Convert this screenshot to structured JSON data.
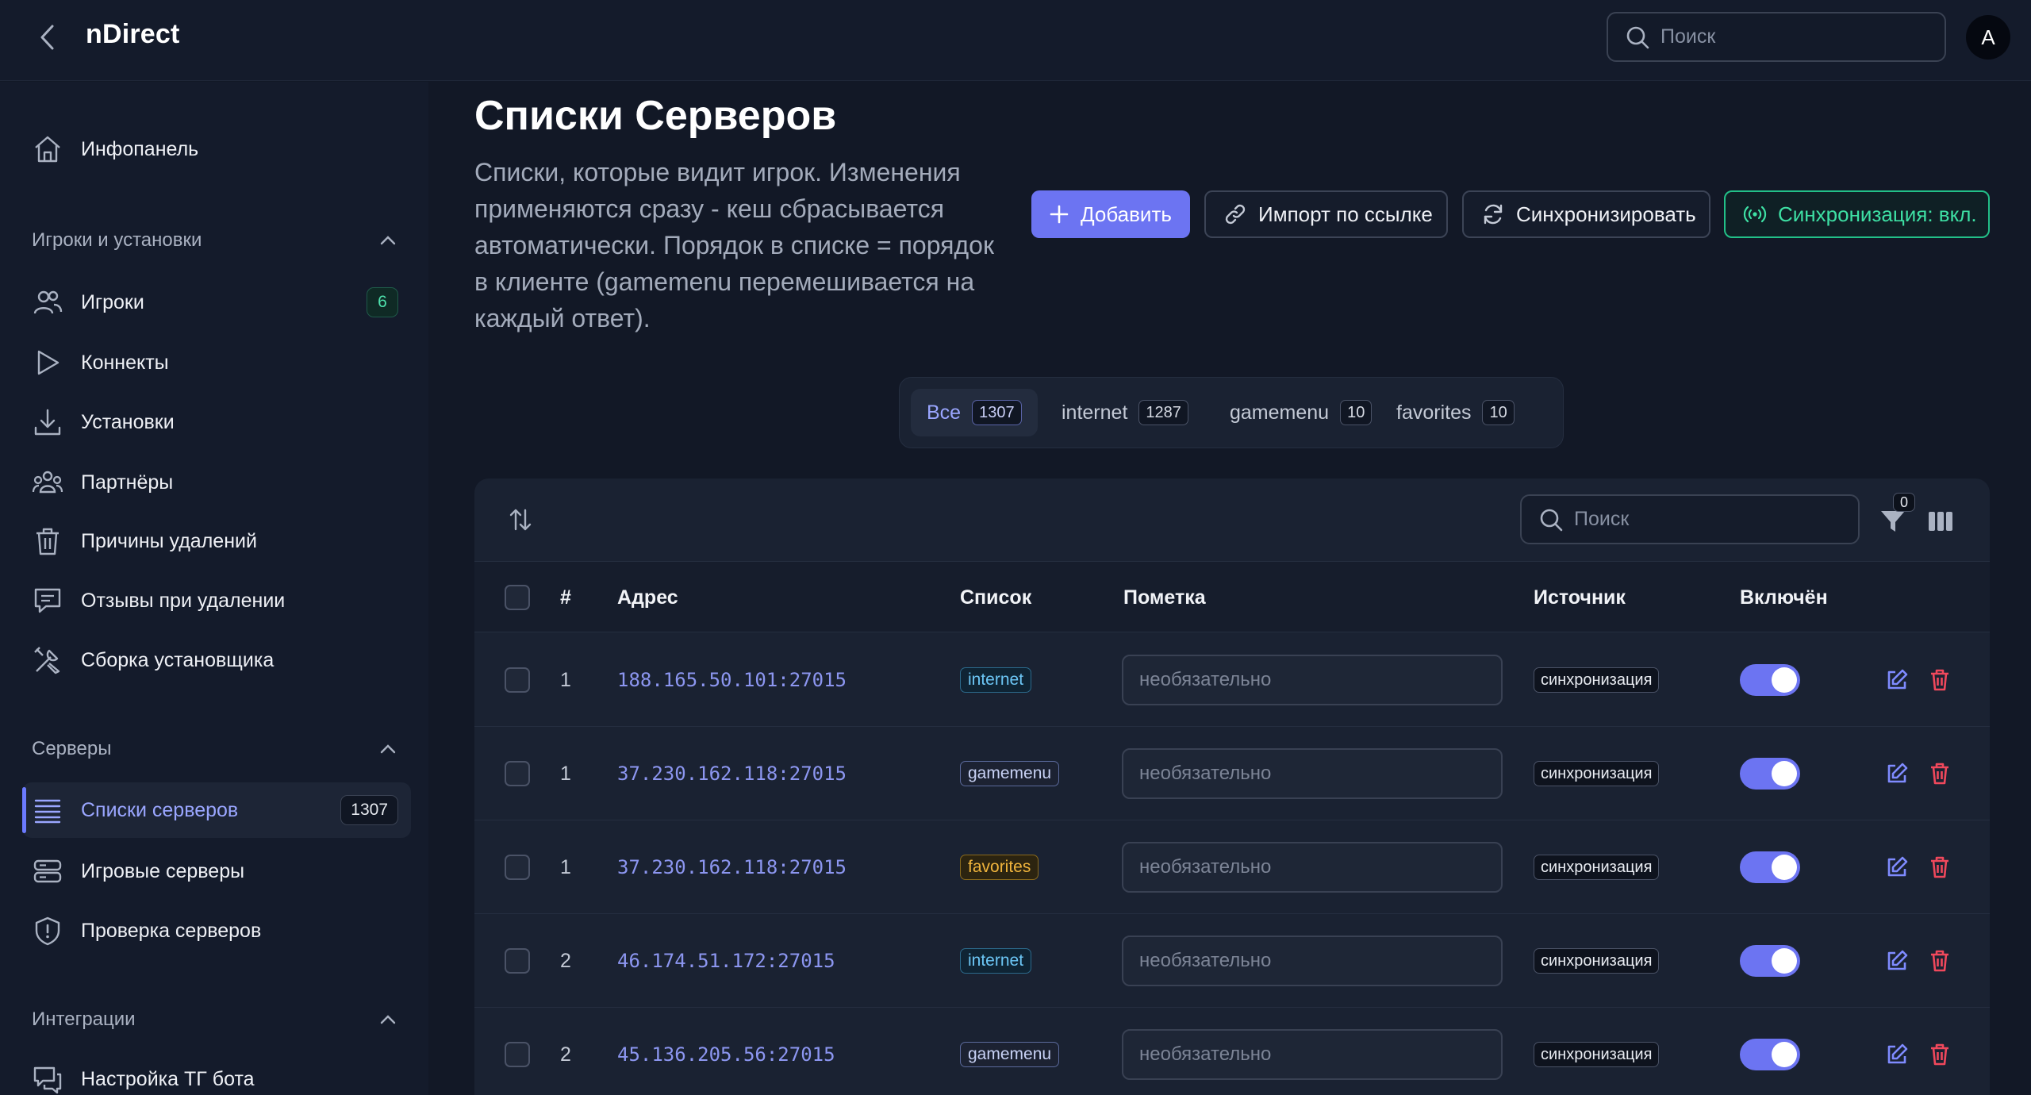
{
  "app": {
    "title": "nDirect"
  },
  "header": {
    "search_placeholder": "Поиск",
    "avatar_initial": "A"
  },
  "sidebar": {
    "items": [
      {
        "label": "Инфопанель"
      }
    ],
    "sections": [
      {
        "title": "Игроки и установки",
        "items": [
          {
            "label": "Игроки",
            "badge": "6"
          },
          {
            "label": "Коннекты"
          },
          {
            "label": "Установки"
          },
          {
            "label": "Партнёры"
          },
          {
            "label": "Причины удалений"
          },
          {
            "label": "Отзывы при удалении"
          },
          {
            "label": "Сборка установщика"
          }
        ]
      },
      {
        "title": "Серверы",
        "items": [
          {
            "label": "Списки серверов",
            "badge": "1307"
          },
          {
            "label": "Игровые серверы"
          },
          {
            "label": "Проверка серверов"
          }
        ]
      },
      {
        "title": "Интеграции",
        "items": [
          {
            "label": "Настройка ТГ бота"
          }
        ]
      }
    ]
  },
  "page": {
    "title": "Списки Серверов",
    "description": "Списки, которые видит игрок. Изменения применяются сразу - кеш сбрасывается автоматически. Порядок в списке = порядок в клиенте (gamemenu перемешивается на каждый ответ).",
    "actions": {
      "add": "Добавить",
      "import": "Импорт по ссылке",
      "sync": "Синхронизировать",
      "sync_status": "Синхронизация: вкл."
    }
  },
  "tabs": [
    {
      "label": "Все",
      "count": "1307"
    },
    {
      "label": "internet",
      "count": "1287"
    },
    {
      "label": "gamemenu",
      "count": "10"
    },
    {
      "label": "favorites",
      "count": "10"
    }
  ],
  "table": {
    "search_placeholder": "Поиск",
    "filter_count": "0",
    "columns": {
      "num": "#",
      "address": "Адрес",
      "list": "Список",
      "note": "Пометка",
      "source": "Источник",
      "enabled": "Включён"
    },
    "note_placeholder": "необязательно",
    "rows": [
      {
        "num": "1",
        "address": "188.165.50.101:27015",
        "list": "internet",
        "source": "синхронизация"
      },
      {
        "num": "1",
        "address": "37.230.162.118:27015",
        "list": "gamemenu",
        "source": "синхронизация"
      },
      {
        "num": "1",
        "address": "37.230.162.118:27015",
        "list": "favorites",
        "source": "синхронизация"
      },
      {
        "num": "2",
        "address": "46.174.51.172:27015",
        "list": "internet",
        "source": "синхронизация"
      },
      {
        "num": "2",
        "address": "45.136.205.56:27015",
        "list": "gamemenu",
        "source": "синхронизация"
      }
    ]
  },
  "colors": {
    "accent": "#6c74f2",
    "success": "#22c088",
    "danger": "#f0485c",
    "background": "#121826"
  },
  "icons": {
    "back": "chevron-left-icon",
    "search": "search-icon",
    "dashboard": "home-icon",
    "players": "users-icon",
    "connects": "play-icon",
    "installs": "download-icon",
    "partners": "group-icon",
    "removal_reasons": "trash-icon",
    "reviews": "message-icon",
    "builder": "tools-icon",
    "server_lists": "list-icon",
    "game_servers": "server-icon",
    "server_check": "shield-icon",
    "telegram": "chat-icon",
    "edit": "edit-icon",
    "delete": "trash-icon"
  }
}
